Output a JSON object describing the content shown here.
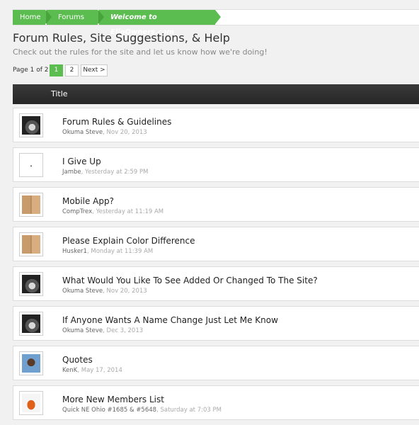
{
  "breadcrumb": {
    "home": "Home",
    "forums": "Forums",
    "current": "Welcome to ElioOwners.com"
  },
  "forum": {
    "title": "Forum Rules, Site Suggestions, & Help",
    "description": "Check out the rules for the site and let us know how we're doing!"
  },
  "pagination": {
    "label": "Page 1 of 2",
    "current": "1",
    "page2": "2",
    "next": "Next >"
  },
  "table": {
    "header": "Title"
  },
  "threads": [
    {
      "title": "Forum Rules & Guidelines",
      "author": "Okuma Steve",
      "date": ", Nov 20, 2013",
      "avatar": "car-dark"
    },
    {
      "title": "I Give Up",
      "author": "Jambe",
      "date": ", Yesterday at 2:59 PM",
      "avatar": "blank"
    },
    {
      "title": "Mobile App?",
      "author": "CompTrex",
      "date": ", Yesterday at 11:19 AM",
      "avatar": "couple-photo"
    },
    {
      "title": "Please Explain Color Difference",
      "author": "Husker1",
      "date": ", Monday at 11:39 AM",
      "avatar": "couple-photo"
    },
    {
      "title": "What Would You Like To See Added Or Changed To The Site?",
      "author": "Okuma Steve",
      "date": ", Nov 20, 2013",
      "avatar": "car-dark"
    },
    {
      "title": "If Anyone Wants A Name Change Just Let Me Know",
      "author": "Okuma Steve",
      "date": ", Dec 3, 2013",
      "avatar": "car-dark"
    },
    {
      "title": "Quotes",
      "author": "KenK",
      "date": ", May 17, 2014",
      "avatar": "person-sky"
    },
    {
      "title": "More New Members List",
      "author": "Quick NE Ohio #1685 & #5648",
      "date": ", Saturday at 7:03 PM",
      "avatar": "car-orange"
    }
  ],
  "colors": {
    "accent": "#5bbd4f",
    "header_bg": "#2e2e2e"
  }
}
